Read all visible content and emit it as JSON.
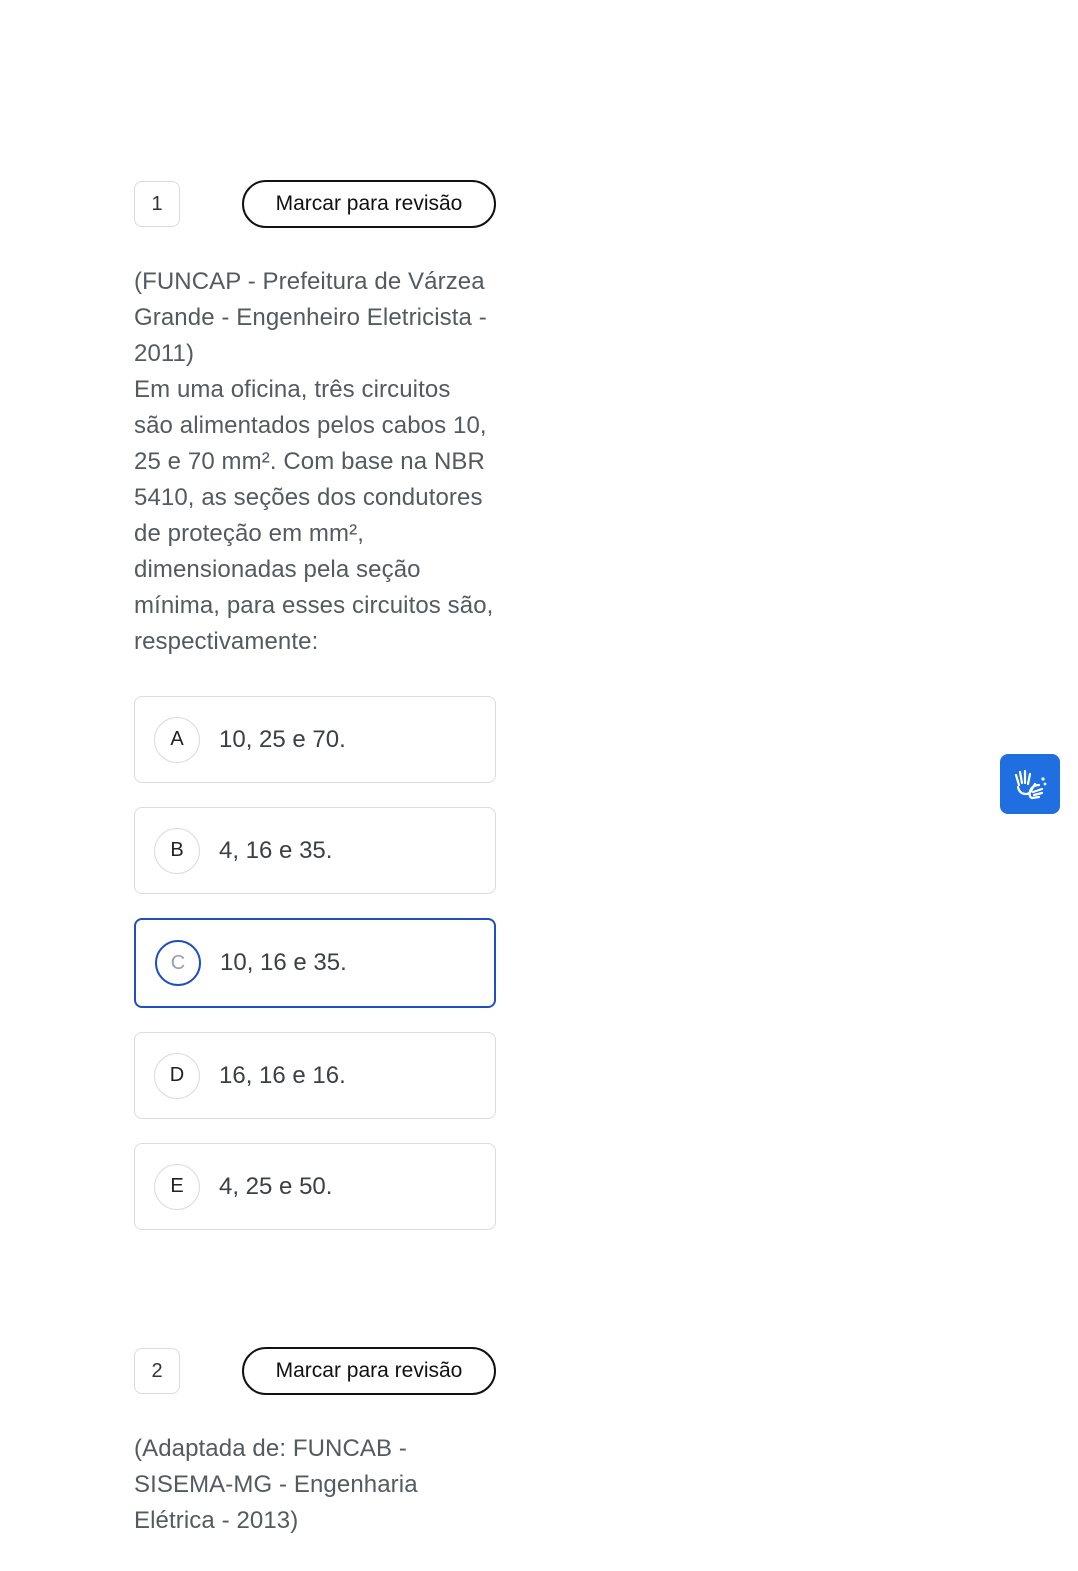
{
  "questions": [
    {
      "number": "1",
      "review_label": "Marcar para revisão",
      "source": "(FUNCAP - Prefeitura de Várzea Grande - Engenheiro Eletricista - 2011)",
      "text": "Em uma oficina, três circuitos são alimentados pelos cabos 10, 25 e 70 mm². Com base na NBR 5410, as seções dos condutores de proteção em mm², dimensionadas pela seção mínima, para esses circuitos são, respectivamente:",
      "options": [
        {
          "letter": "A",
          "text": "10, 25 e 70."
        },
        {
          "letter": "B",
          "text": "4, 16 e 35."
        },
        {
          "letter": "C",
          "text": "10, 16 e 35.",
          "selected": true
        },
        {
          "letter": "D",
          "text": "16, 16 e 16."
        },
        {
          "letter": "E",
          "text": "4, 25 e 50."
        }
      ]
    },
    {
      "number": "2",
      "review_label": "Marcar para revisão",
      "source": "(Adaptada de: FUNCAB - SISEMA-MG - Engenharia Elétrica - 2013)"
    }
  ],
  "accessibility_button": {
    "icon": "sign-language-hands-icon",
    "color": "#1f6fe0"
  },
  "colors": {
    "selected_border": "#1f4fc1",
    "text_muted": "#555a5f"
  }
}
